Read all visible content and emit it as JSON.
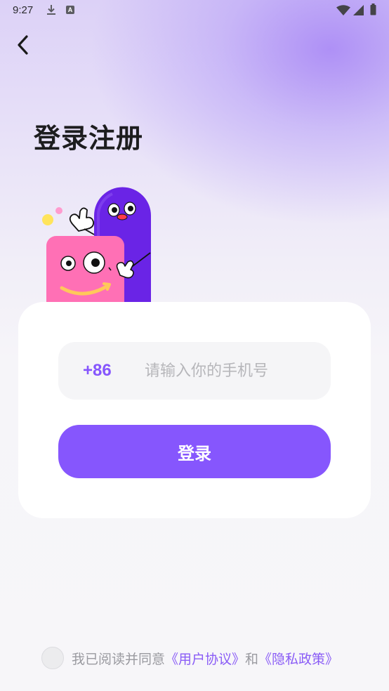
{
  "status_bar": {
    "time": "9:27",
    "left_icons": [
      "download-icon",
      "text-input-icon"
    ],
    "text_icon_letter": "A",
    "right_icons": [
      "wifi-icon",
      "cell-signal-icon",
      "battery-icon"
    ]
  },
  "nav": {
    "back_icon": "chevron-left-icon"
  },
  "header": {
    "title": "登录注册"
  },
  "login_form": {
    "country_code": "+86",
    "phone_input": {
      "value": "",
      "placeholder": "请输入你的手机号"
    },
    "submit_label": "登录"
  },
  "agreement": {
    "checked": false,
    "prefix": "我已阅读并同意",
    "user_agreement_link": "《用户协议》",
    "conjunction": "和",
    "privacy_policy_link": "《隐私政策》"
  },
  "colors": {
    "accent": "#8656FD",
    "link": "#8A5CF6",
    "title": "#1D1D1F",
    "placeholder": "#B6B6BA",
    "muted_text": "#9A9AA0",
    "card": "#FFFFFF",
    "input_bg": "#F5F5F7"
  }
}
